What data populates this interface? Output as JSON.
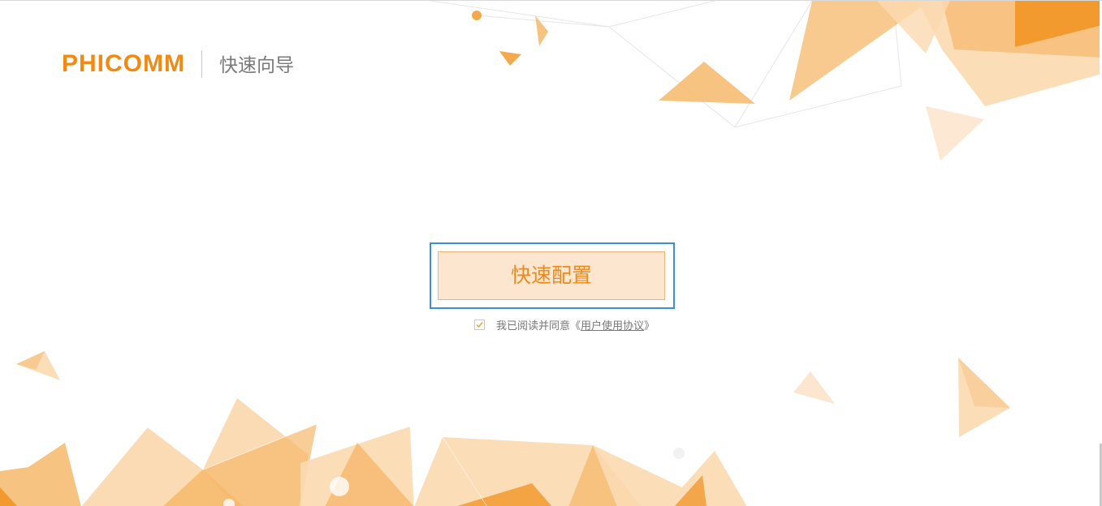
{
  "header": {
    "logo_text": "PHICOMM",
    "subtitle": "快速向导"
  },
  "main": {
    "quick_config_label": "快速配置",
    "agreement": {
      "checked": true,
      "prefix_text": "我已阅读并同意",
      "open_bracket": "《",
      "link_text": "用户使用协议",
      "close_bracket": "》"
    }
  },
  "colors": {
    "brand_orange": "#f08a12",
    "button_fill": "#fde6cf",
    "button_border": "#f3b477",
    "focus_outline": "#3a8fd6",
    "decor_orange_light": "#fbd9b0",
    "decor_orange_mid": "#f6b86b",
    "decor_orange_dark": "#f29a2e"
  }
}
